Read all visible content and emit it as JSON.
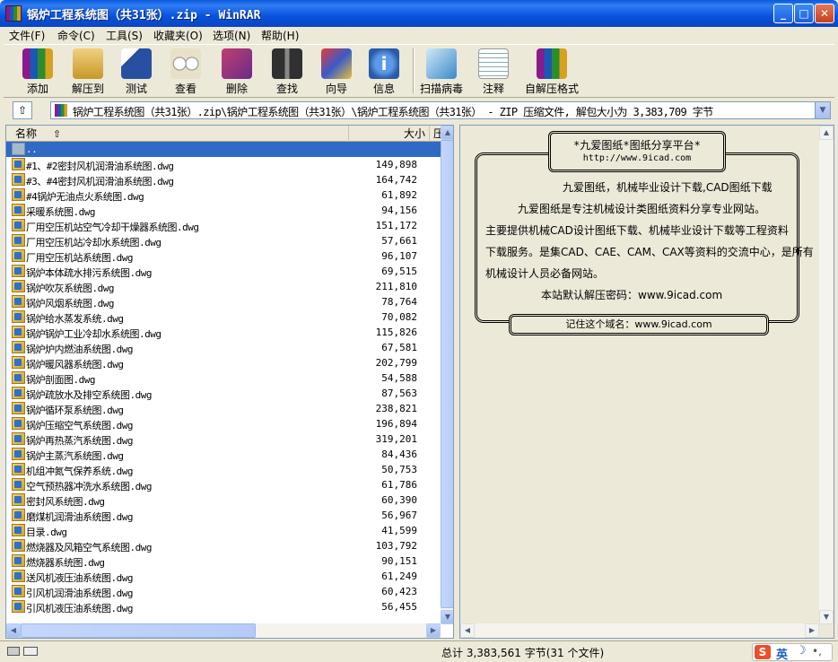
{
  "window": {
    "title": "锅炉工程系统图（共31张）.zip - WinRAR",
    "minimize": "_",
    "maximize": "□",
    "close": "✕"
  },
  "menu": [
    "文件(F)",
    "命令(C)",
    "工具(S)",
    "收藏夹(O)",
    "选项(N)",
    "帮助(H)"
  ],
  "toolbar": [
    {
      "label": "添加",
      "icon": "add-books-icon",
      "color": "#8b3a8b"
    },
    {
      "label": "解压到",
      "icon": "extract-folder-icon",
      "color": "#d8a830"
    },
    {
      "label": "测试",
      "icon": "test-clipboard-icon",
      "color": "#2850a0"
    },
    {
      "label": "查看",
      "icon": "view-glasses-icon",
      "color": "#c8c0a8"
    },
    {
      "label": "删除",
      "icon": "delete-book-icon",
      "color": "#a83060"
    },
    {
      "label": "查找",
      "icon": "find-binoculars-icon",
      "color": "#404040"
    },
    {
      "label": "向导",
      "icon": "wizard-icon",
      "color": "#6a3aa0"
    },
    {
      "label": "信息",
      "icon": "info-icon",
      "color": "#3a78c8"
    },
    {
      "label": "扫描病毒",
      "icon": "scan-virus-icon",
      "color": "#3a8ac8"
    },
    {
      "label": "注释",
      "icon": "comment-note-icon",
      "color": "#e8e0c0"
    },
    {
      "label": "自解压格式",
      "icon": "sfx-archive-icon",
      "color": "#6a9a2a"
    }
  ],
  "address": {
    "up_icon": "⇧",
    "path": "锅炉工程系统图（共31张）.zip\\锅炉工程系统图（共31张）\\锅炉工程系统图（共31张） - ZIP 压缩文件, 解包大小为 3,383,709 字节",
    "dropdown": "▼"
  },
  "list": {
    "col_name": "名称",
    "col_size": "大小",
    "col_packed": "压",
    "sort_icon": "⇧",
    "parent": "..",
    "files": [
      {
        "name": "#1、#2密封风机润滑油系统图.dwg",
        "size": "149,898"
      },
      {
        "name": "#3、#4密封风机润滑油系统图.dwg",
        "size": "164,742"
      },
      {
        "name": "#4锅炉无油点火系统图.dwg",
        "size": "61,892"
      },
      {
        "name": "采暖系统图.dwg",
        "size": "94,156"
      },
      {
        "name": "厂用空压机站空气冷却干燥器系统图.dwg",
        "size": "151,172"
      },
      {
        "name": "厂用空压机站冷却水系统图.dwg",
        "size": "57,661"
      },
      {
        "name": "厂用空压机站系统图.dwg",
        "size": "96,107"
      },
      {
        "name": "锅炉本体疏水排污系统图.dwg",
        "size": "69,515"
      },
      {
        "name": "锅炉吹灰系统图.dwg",
        "size": "211,810"
      },
      {
        "name": "锅炉风烟系统图.dwg",
        "size": "78,764"
      },
      {
        "name": "锅炉给水蒸发系统.dwg",
        "size": "70,082"
      },
      {
        "name": "锅炉锅炉工业冷却水系统图.dwg",
        "size": "115,826"
      },
      {
        "name": "锅炉炉内燃油系统图.dwg",
        "size": "67,581"
      },
      {
        "name": "锅炉暖风器系统图.dwg",
        "size": "202,799"
      },
      {
        "name": "锅炉剖面图.dwg",
        "size": "54,588"
      },
      {
        "name": "锅炉疏放水及排空系统图.dwg",
        "size": "87,563"
      },
      {
        "name": "锅炉循环泵系统图.dwg",
        "size": "238,821"
      },
      {
        "name": "锅炉压缩空气系统图.dwg",
        "size": "196,894"
      },
      {
        "name": "锅炉再热蒸汽系统图.dwg",
        "size": "319,201"
      },
      {
        "name": "锅炉主蒸汽系统图.dwg",
        "size": "84,436"
      },
      {
        "name": "机组冲氮气保养系统.dwg",
        "size": "50,753"
      },
      {
        "name": "空气预热器冲洗水系统图.dwg",
        "size": "61,786"
      },
      {
        "name": "密封风系统图.dwg",
        "size": "60,390"
      },
      {
        "name": "磨煤机润滑油系统图.dwg",
        "size": "56,967"
      },
      {
        "name": "目录.dwg",
        "size": "41,599"
      },
      {
        "name": "燃烧器及风箱空气系统图.dwg",
        "size": "103,792"
      },
      {
        "name": "燃烧器系统图.dwg",
        "size": "90,151"
      },
      {
        "name": "送风机液压油系统图.dwg",
        "size": "61,249"
      },
      {
        "name": "引风机润滑油系统图.dwg",
        "size": "60,423"
      },
      {
        "name": "引风机液压油系统图.dwg",
        "size": "56,455"
      }
    ]
  },
  "comment": {
    "header_title": "*九爱图纸*图纸分享平台*",
    "header_url": "http://www.9icad.com",
    "line1": "九爱图纸，机械毕业设计下载,CAD图纸下载",
    "line2": "九爱图纸是专注机械设计类图纸资料分享专业网站。",
    "line3": "主要提供机械CAD设计图纸下载、机械毕业设计下载等工程资料",
    "line4": "下载服务。是集CAD、CAE、CAM、CAX等资料的交流中心，是所有",
    "line5": "机械设计人员必备网站。",
    "line6": "本站默认解压密码：www.9icad.com",
    "footer": "记住这个域名：www.9icad.com"
  },
  "status": {
    "summary": "总计 3,383,561 字节(31 个文件)",
    "ime_logo": "S",
    "ime_lang": "英",
    "ime_moon": "☽",
    "ime_dots": "•,"
  }
}
